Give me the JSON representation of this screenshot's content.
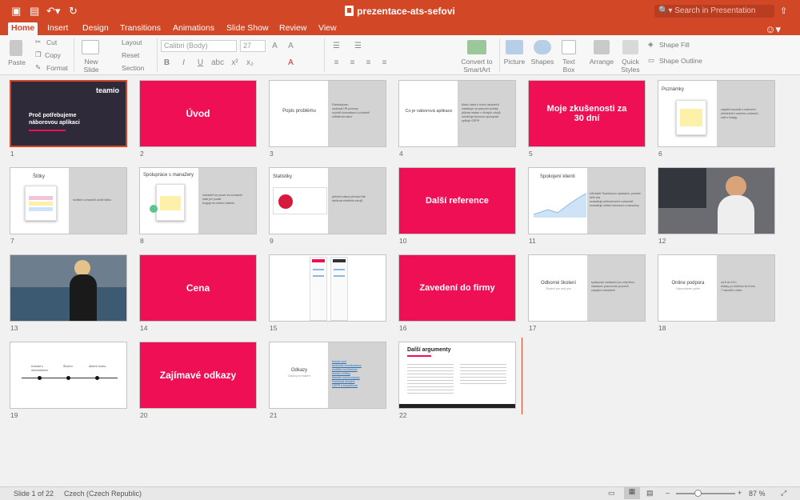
{
  "app": {
    "doc_title": "prezentace-ats-sefovi",
    "search_placeholder": "Search in Presentation"
  },
  "tabs": [
    "Home",
    "Insert",
    "Design",
    "Transitions",
    "Animations",
    "Slide Show",
    "Review",
    "View"
  ],
  "ribbon": {
    "paste": "Paste",
    "cut": "Cut",
    "copy": "Copy",
    "format": "Format",
    "new_slide": "New Slide",
    "layout": "Layout",
    "reset": "Reset",
    "section": "Section",
    "font": "Calibri (Body)",
    "font_size": "27",
    "convert": "Convert to SmartArt",
    "picture": "Picture",
    "shapes": "Shapes",
    "textbox": "Text Box",
    "arrange": "Arrange",
    "quick_styles": "Quick Styles",
    "shape_fill": "Shape Fill",
    "shape_outline": "Shape Outline"
  },
  "slides": [
    {
      "n": "1",
      "title": "Proč potřebujeme náborovou aplikaci",
      "logo": "teamio"
    },
    {
      "n": "2",
      "title": "Úvod"
    },
    {
      "n": "3",
      "title": "Popis problému",
      "bullets": [
        "Potřebujeme:",
        "zautovat HR procesy",
        "urychlit komunikaci s uchazeči",
        "zefektivnit nábor",
        "vyhledávat komunikaci a řízení"
      ]
    },
    {
      "n": "4",
      "title": "Co je náborová aplikace",
      "bullets": [
        "Místo, které k řízení uchazečů",
        "nastavuje na pracovní portály",
        "příjímá reakce z různých zdrojů",
        "umožňuje týmovou spolupráci",
        "splňuje GDPR"
      ]
    },
    {
      "n": "5",
      "title": "Moje zkušenosti za 30 dní"
    },
    {
      "n": "6",
      "title": "Poznámky",
      "bullets": [
        "zápisků souvislé s reakcemi",
        "přehledně k danému uchazeči",
        "sdílí s kolegy"
      ]
    },
    {
      "n": "7",
      "title": "Štítky",
      "bullets": [
        "rozlišení uchazečů podle štítku"
      ]
    },
    {
      "n": "8",
      "title": "Spolupráce s manažery",
      "bullets": [
        "manažeři se pouze za uchazeče",
        "stačí jen poslat",
        "fungují na mobilu i tabletu"
      ]
    },
    {
      "n": "9",
      "title": "Statistiky",
      "bullets": [
        "přehled odkud přichází lidé",
        "sledovat efektivitu zdrojů"
      ]
    },
    {
      "n": "10",
      "title": "Další reference"
    },
    {
      "n": "11",
      "title": "Spokojení klienti",
      "bullets": [
        "Uživatelé Teamia jsou spokojení, protože:",
        "šetří čas",
        "usnadňuje přehodnocení uchazečů",
        "usnadňuje sdílení informací s manažery"
      ]
    },
    {
      "n": "12",
      "title": ""
    },
    {
      "n": "13",
      "title": ""
    },
    {
      "n": "14",
      "title": "Cena"
    },
    {
      "n": "15",
      "title": ""
    },
    {
      "n": "16",
      "title": "Zavedení do firmy"
    },
    {
      "n": "17",
      "title": "Odborné školení",
      "sub": "Školení pro celý tým",
      "bullets": [
        "spoluprací nastavení pro celý firmu",
        "nastavení pracovních procesů",
        "zapojení manažerů"
      ]
    },
    {
      "n": "18",
      "title": "Online podpora",
      "sub": "Odpovídáme rychle",
      "bullets": [
        "od 8 do 16 h",
        "dotazy po telefonu do 5 min",
        "7 návodů k videu"
      ]
    },
    {
      "n": "19",
      "title": "",
      "timeline": [
        "Kontakt s obchodníkem",
        "Školení",
        "Aktivní tvorba"
      ]
    },
    {
      "n": "20",
      "title": "Zajímavé odkazy"
    },
    {
      "n": "21",
      "title": "Odkazy",
      "sub": "Odkazy ke stažení",
      "links": [
        "teamio.com",
        "facebook.com/teamiocz",
        "youtube.com/teamio",
        "teamio.cz/blog",
        "linkedin.com/company",
        "Facebook skupina",
        "GDPR a bezpečnost"
      ]
    },
    {
      "n": "22",
      "title": "Další argumenty"
    }
  ],
  "status": {
    "slide": "Slide 1 of 22",
    "language": "Czech (Czech Republic)",
    "zoom": "87 %"
  },
  "colors": {
    "accent": "#d24726",
    "pink": "#ee0f55",
    "dark": "#2f2a3a"
  }
}
